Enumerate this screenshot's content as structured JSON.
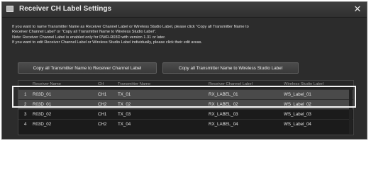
{
  "dialog": {
    "title": "Receiver CH Label Settings",
    "close_glyph": "✕"
  },
  "description": {
    "line1": "If you want to name Transmitter Name as Receiver Channel Label or Wireless Studio Label, please click \"Copy all Transmitter Name to",
    "line2": "Receiver Channel Label\" or \"Copy all Transmitter Name to Wireless Studio Label\".",
    "line3": "Note: Receiver Channel Label is enabled only for DWR-R03D with version 1.31 or later.",
    "line4": "If you want to edit Receiver Channel Label or Wireless Studio Label individually, please click their edit areas."
  },
  "buttons": {
    "copy_to_receiver": "Copy all Transmitter Name to Receiver Channel Label",
    "copy_to_wireless": "Copy all Transmitter Name to Wireless Studio Label"
  },
  "table": {
    "headers": {
      "receiver_name": "Receiver Name",
      "ch": "CH",
      "transmitter_name": "Transmitter Name",
      "receiver_channel_label": "Receiver Channel Label",
      "wireless_studio_label": "Wireless Studio Label"
    },
    "rows": [
      {
        "num": "1",
        "receiver": "R03D_01",
        "ch": "CH1",
        "tx": "TX_01",
        "rx_label": "RX_LABEL_01",
        "ws_label": "WS_Label_01"
      },
      {
        "num": "2",
        "receiver": "R03D_01",
        "ch": "CH2",
        "tx": "TX_02",
        "rx_label": "RX_LABEL_02",
        "ws_label": "WS_Label_02"
      },
      {
        "num": "3",
        "receiver": "R03D_02",
        "ch": "CH1",
        "tx": "TX_03",
        "rx_label": "RX_LABEL_03",
        "ws_label": "WS_Label_03"
      },
      {
        "num": "4",
        "receiver": "R03D_02",
        "ch": "CH2",
        "tx": "TX_04",
        "rx_label": "RX_LABEL_04",
        "ws_label": "WS_Label_04"
      }
    ]
  },
  "icons": {
    "app": "app-icon",
    "close": "close-icon"
  }
}
